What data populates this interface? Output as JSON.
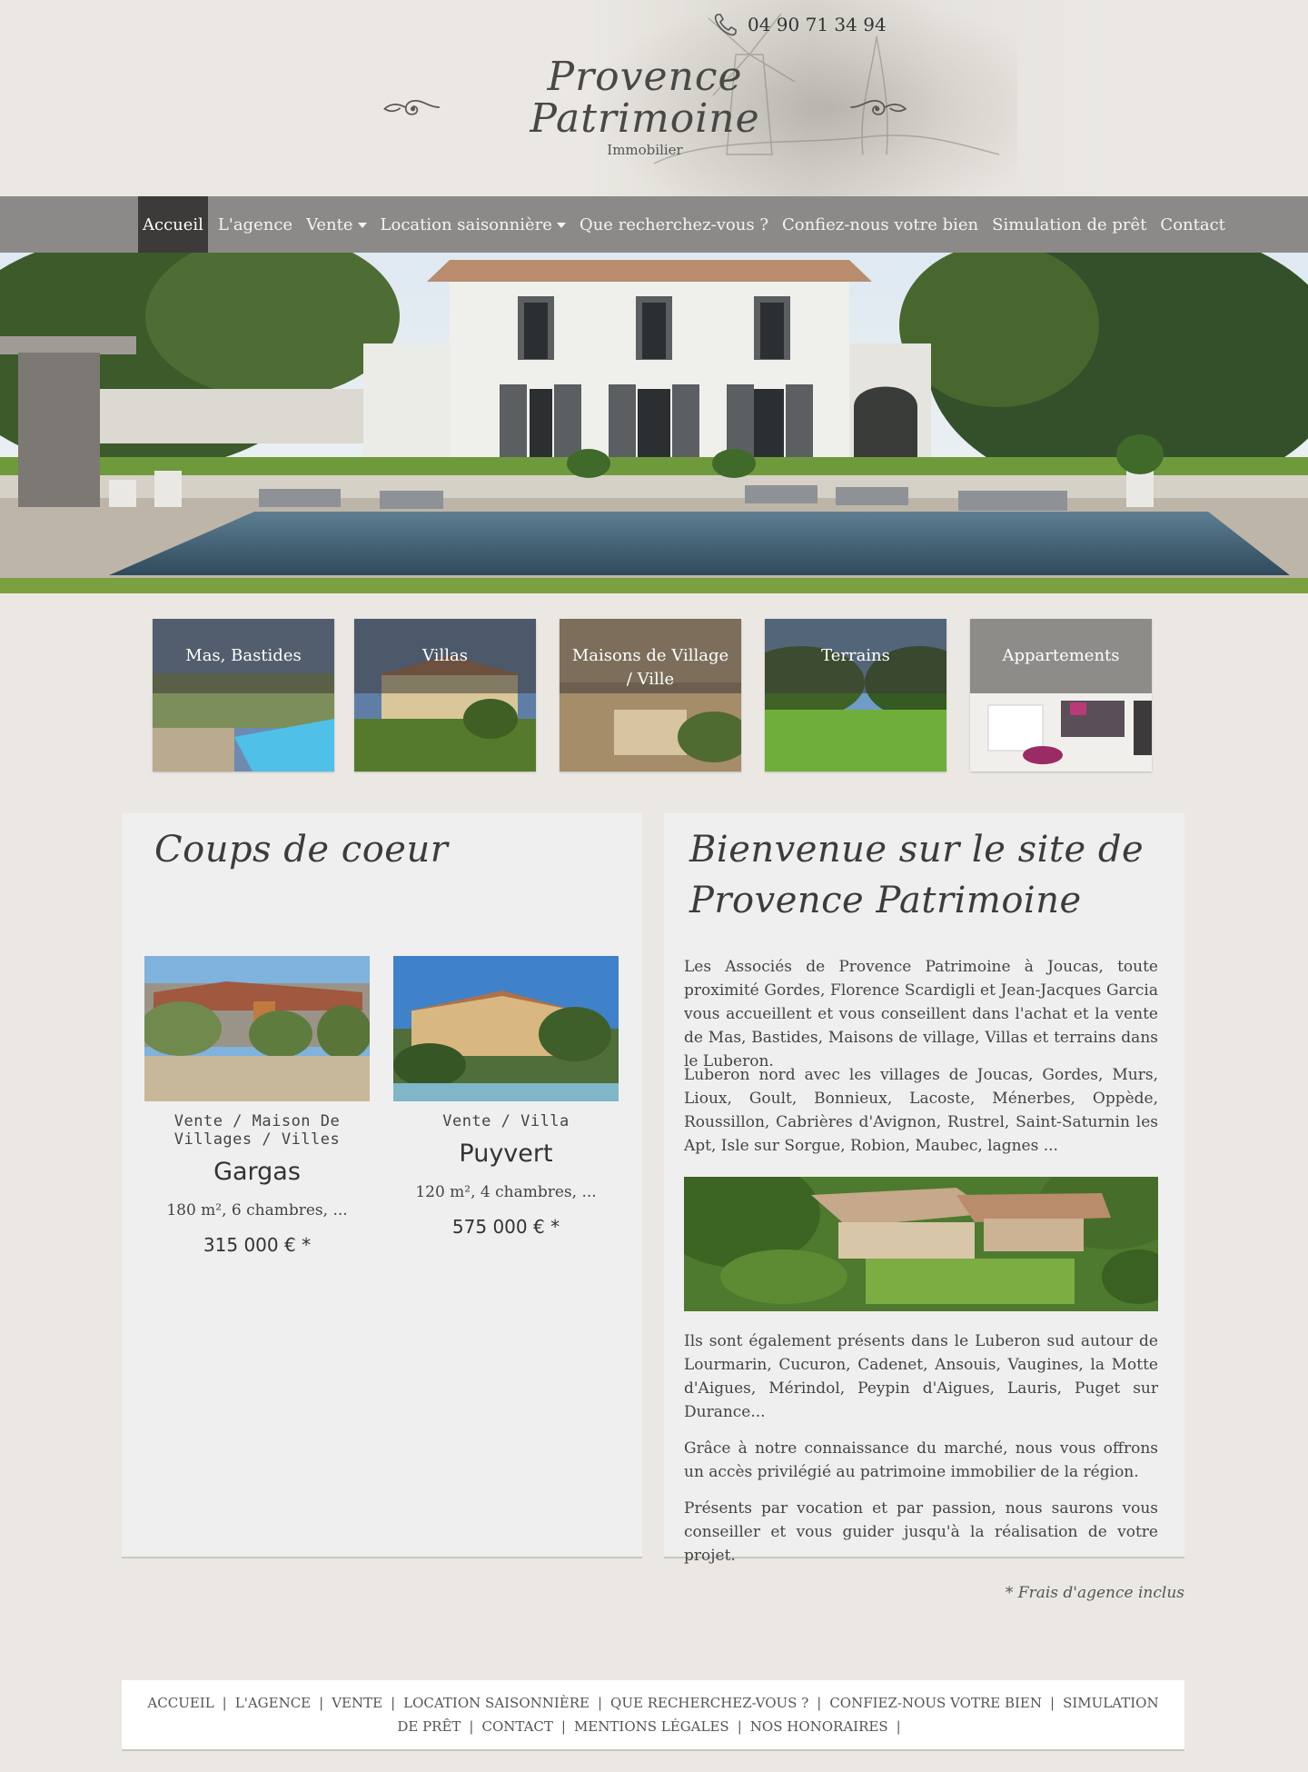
{
  "header": {
    "phone": "04 90 71 34 94",
    "brand_title": "Provence Patrimoine",
    "brand_subtitle": "Immobilier"
  },
  "nav": {
    "items": [
      {
        "label": "Accueil",
        "active": true,
        "dropdown": false
      },
      {
        "label": "L'agence",
        "active": false,
        "dropdown": false
      },
      {
        "label": "Vente",
        "active": false,
        "dropdown": true
      },
      {
        "label": "Location saisonnière",
        "active": false,
        "dropdown": true
      },
      {
        "label": "Que recherchez-vous ?",
        "active": false,
        "dropdown": false
      },
      {
        "label": "Confiez-nous votre bien",
        "active": false,
        "dropdown": false
      },
      {
        "label": "Simulation de prêt",
        "active": false,
        "dropdown": false
      },
      {
        "label": "Contact",
        "active": false,
        "dropdown": false
      }
    ]
  },
  "categories": [
    {
      "label": "Mas, Bastides"
    },
    {
      "label": "Villas"
    },
    {
      "label": "Maisons de Village / Ville"
    },
    {
      "label": "Terrains"
    },
    {
      "label": "Appartements"
    }
  ],
  "featured": {
    "title": "Coups de coeur",
    "cards": [
      {
        "category": "Vente / Maison De Villages / Villes",
        "city": "Gargas",
        "description": "180 m², 6 chambres, ...",
        "price": "315 000 € *"
      },
      {
        "category": "Vente / Villa",
        "city": "Puyvert",
        "description": "120 m², 4 chambres, ...",
        "price": "575 000 € *"
      }
    ]
  },
  "welcome": {
    "title": "Bienvenue sur le site de Provence Patrimoine",
    "paragraphs": [
      "Les Associés de Provence Patrimoine à Joucas, toute proximité Gordes, Florence Scardigli et Jean-Jacques Garcia vous accueillent et vous conseillent dans l'achat et la vente de Mas, Bastides, Maisons de village, Villas et terrains dans le Luberon.",
      "Luberon nord avec les villages de Joucas, Gordes, Murs, Lioux, Goult, Bonnieux, Lacoste, Ménerbes, Oppède, Roussillon, Cabrières d'Avignon, Rustrel, Saint-Saturnin les Apt, Isle sur Sorgue, Robion, Maubec, lagnes ...",
      "Ils sont également présents dans le Luberon sud autour de Lourmarin, Cucuron, Cadenet, Ansouis, Vaugines, la Motte d'Aigues, Mérindol, Peypin d'Aigues, Lauris, Puget sur Durance...",
      "Grâce à notre connaissance du marché, nous vous offrons un accès privilégié au patrimoine immobilier de la région.",
      "Présents par vocation et par passion, nous saurons vous conseiller et vous guider jusqu'à la réalisation de votre projet."
    ]
  },
  "footnote": "* Frais d'agence inclus",
  "footer": {
    "links": [
      "ACCUEIL",
      "L'AGENCE",
      "VENTE",
      "LOCATION SAISONNIÈRE",
      "QUE RECHERCHEZ-VOUS ?",
      "CONFIEZ-NOUS VOTRE BIEN",
      "SIMULATION DE PRÊT",
      "CONTACT",
      "MENTIONS LÉGALES",
      "NOS HONORAIRES"
    ]
  }
}
